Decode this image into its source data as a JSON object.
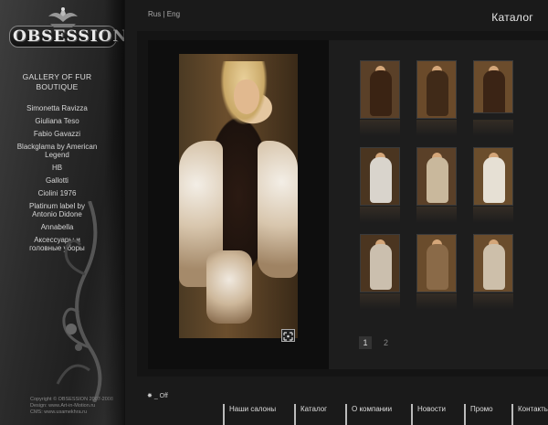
{
  "brand": {
    "logo_text": "OBSESSION",
    "subtitle_line1": "GALLERY OF FUR",
    "subtitle_line2": "BOUTIQUE"
  },
  "sidebar": {
    "items": [
      {
        "label": "Simonetta Ravizza"
      },
      {
        "label": "Giuliana Teso"
      },
      {
        "label": "Fabio Gavazzi"
      },
      {
        "label": "Blackglama by American Legend"
      },
      {
        "label": "HB"
      },
      {
        "label": "Gallotti"
      },
      {
        "label": "Ciolini 1976"
      },
      {
        "label": "Platinum label by Antonio Didone"
      },
      {
        "label": "Annabella"
      },
      {
        "label": "Аксессуары и головные уборы"
      }
    ],
    "copyright_line1": "Copyright © OBSESSION 2007-2008",
    "copyright_line2": "Design: www.Art-in-Motion.ru",
    "copyright_line3": "CMS: www.usamekhra.ru"
  },
  "header": {
    "lang_rus": "Rus",
    "lang_sep": "|",
    "lang_eng": "Eng",
    "page_title": "Каталог"
  },
  "gallery": {
    "pages": [
      "1",
      "2"
    ],
    "active_page": "1",
    "thumbnails_count": 9
  },
  "sound": {
    "label": "_ Off"
  },
  "bottom_nav": {
    "items": [
      {
        "label": "Наши салоны"
      },
      {
        "label": "Каталог"
      },
      {
        "label": "О компании"
      },
      {
        "label": "Новости"
      },
      {
        "label": "Промо"
      },
      {
        "label": "Контакты"
      }
    ]
  },
  "colors": {
    "background": "#1a1a1a",
    "panel": "#141414",
    "text": "#dddddd"
  }
}
